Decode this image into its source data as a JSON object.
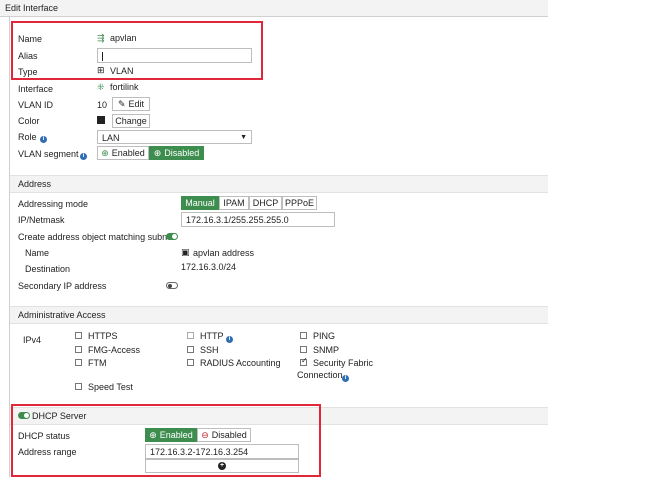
{
  "window": {
    "title": "Edit Interface"
  },
  "general": {
    "name_label": "Name",
    "name_value": "apvlan",
    "alias_label": "Alias",
    "alias_value": "",
    "type_label": "Type",
    "type_value": "VLAN",
    "interface_label": "Interface",
    "interface_value": "fortilink",
    "vlanid_label": "VLAN ID",
    "vlanid_value": "10",
    "edit_label": "Edit",
    "color_label": "Color",
    "change_label": "Change",
    "role_label": "Role",
    "role_value": "LAN",
    "segment_label": "VLAN segment",
    "enabled_label": "Enabled",
    "disabled_label": "Disabled"
  },
  "address": {
    "section_title": "Address",
    "mode_label": "Addressing mode",
    "modes": [
      "Manual",
      "IPAM",
      "DHCP",
      "PPPoE"
    ],
    "ipmask_label": "IP/Netmask",
    "ipmask_value": "172.16.3.1/255.255.255.0",
    "create_obj_label": "Create address object matching subnet",
    "obj_name_label": "Name",
    "obj_name_value": "apvlan address",
    "destination_label": "Destination",
    "destination_value": "172.16.3.0/24",
    "secondary_label": "Secondary IP address"
  },
  "admin": {
    "section_title": "Administrative Access",
    "ipv4_label": "IPv4",
    "col1": [
      "HTTPS",
      "FMG-Access",
      "FTM",
      "Speed Test"
    ],
    "col2": [
      "HTTP",
      "SSH",
      "RADIUS Accounting"
    ],
    "col3": [
      "PING",
      "SNMP",
      "Security Fabric"
    ],
    "col3_cont": "Connection"
  },
  "dhcp": {
    "section_title": "DHCP Server",
    "status_label": "DHCP status",
    "enabled_label": "Enabled",
    "disabled_label": "Disabled",
    "range_label": "Address range",
    "range_value": "172.16.3.2-172.16.3.254"
  },
  "colors": {
    "accent_green": "#3d8d4f",
    "highlight_red": "#e0283a",
    "info_blue": "#2f6db5"
  }
}
